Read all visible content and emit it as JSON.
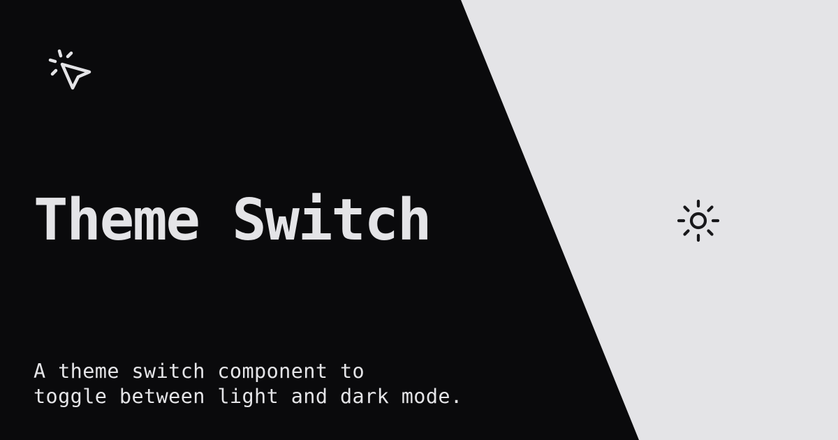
{
  "theme": {
    "dark_bg": "#0a0a0c",
    "light_bg": "#e4e4e7",
    "dark_fg": "#e4e4e7",
    "light_fg": "#18181b"
  },
  "header": {
    "logo_icon": "cursor-click-icon"
  },
  "hero": {
    "title": "Theme Switch",
    "description_line1": "A theme switch component to",
    "description_line2": "toggle between light and dark mode."
  },
  "toggle": {
    "icon": "sun-icon",
    "mode": "light"
  }
}
